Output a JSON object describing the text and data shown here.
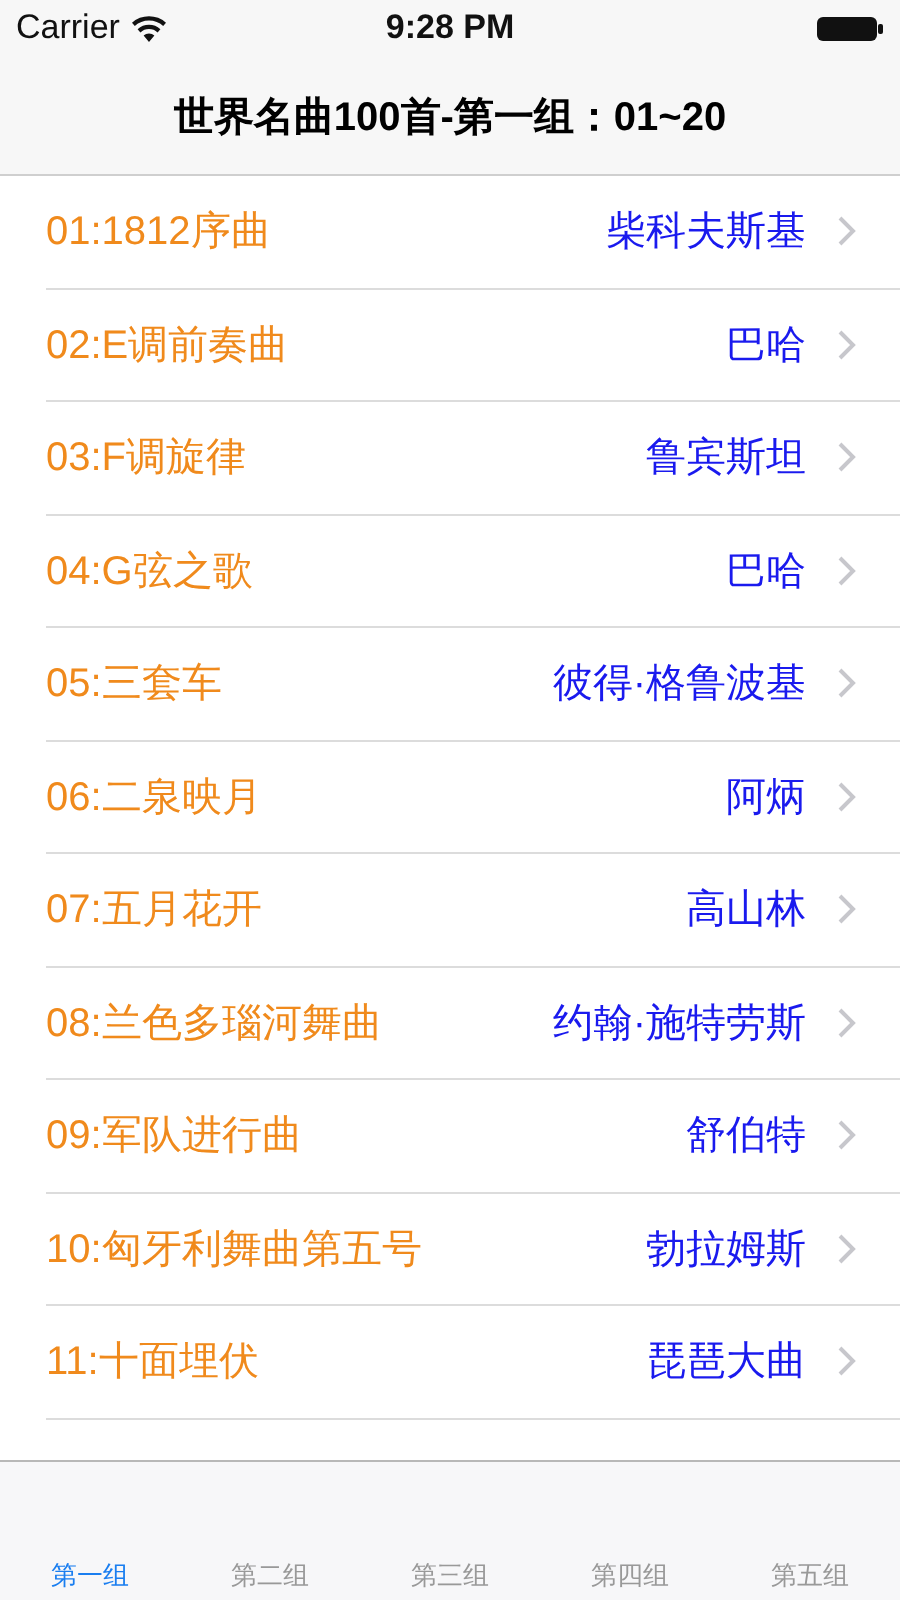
{
  "status_bar": {
    "carrier": "Carrier",
    "time": "9:28 PM"
  },
  "nav_bar": {
    "title": "世界名曲100首-第一组：01~20"
  },
  "songs": [
    {
      "title": "01:1812序曲",
      "composer": "柴科夫斯基"
    },
    {
      "title": "02:E调前奏曲",
      "composer": "巴哈"
    },
    {
      "title": "03:F调旋律",
      "composer": "鲁宾斯坦"
    },
    {
      "title": "04:G弦之歌",
      "composer": "巴哈"
    },
    {
      "title": "05:三套车",
      "composer": "彼得·格鲁波基"
    },
    {
      "title": "06:二泉映月",
      "composer": "阿炳"
    },
    {
      "title": "07:五月花开",
      "composer": "高山林"
    },
    {
      "title": "08:兰色多瑙河舞曲",
      "composer": "约翰·施特劳斯"
    },
    {
      "title": "09:军队进行曲",
      "composer": "舒伯特"
    },
    {
      "title": "10:匈牙利舞曲第五号",
      "composer": "勃拉姆斯"
    },
    {
      "title": "11:十面埋伏",
      "composer": "琵琶大曲"
    }
  ],
  "tabs": [
    {
      "label": "第一组",
      "selected": true
    },
    {
      "label": "第二组",
      "selected": false
    },
    {
      "label": "第三组",
      "selected": false
    },
    {
      "label": "第四组",
      "selected": false
    },
    {
      "label": "第五组",
      "selected": false
    }
  ]
}
